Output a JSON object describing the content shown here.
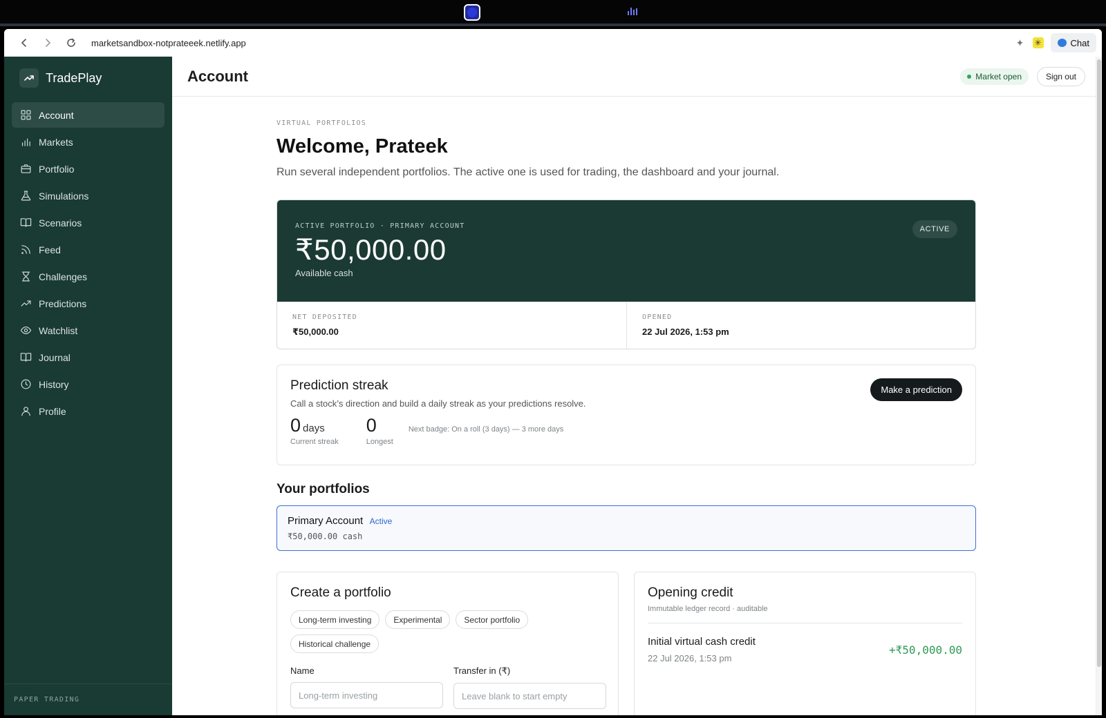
{
  "browser": {
    "url": "marketsandbox-notprateeek.netlify.app",
    "chat_label": "Chat"
  },
  "sidebar": {
    "brand": "TradePlay",
    "items": [
      {
        "label": "Account",
        "icon": "grid-icon"
      },
      {
        "label": "Markets",
        "icon": "bar-chart-icon"
      },
      {
        "label": "Portfolio",
        "icon": "briefcase-icon"
      },
      {
        "label": "Simulations",
        "icon": "flask-icon"
      },
      {
        "label": "Scenarios",
        "icon": "book-open-icon"
      },
      {
        "label": "Feed",
        "icon": "rss-icon"
      },
      {
        "label": "Challenges",
        "icon": "hourglass-icon"
      },
      {
        "label": "Predictions",
        "icon": "trending-up-icon"
      },
      {
        "label": "Watchlist",
        "icon": "eye-icon"
      },
      {
        "label": "Journal",
        "icon": "book-icon"
      },
      {
        "label": "History",
        "icon": "clock-icon"
      },
      {
        "label": "Profile",
        "icon": "user-icon"
      }
    ],
    "footer": "PAPER TRADING"
  },
  "header": {
    "title": "Account",
    "market_status": "Market open",
    "sign_out": "Sign out"
  },
  "intro": {
    "eyebrow": "VIRTUAL PORTFOLIOS",
    "welcome": "Welcome, Prateek",
    "lead": "Run several independent portfolios. The active one is used for trading, the dashboard and your journal."
  },
  "active_portfolio": {
    "eyebrow": "ACTIVE PORTFOLIO · PRIMARY ACCOUNT",
    "amount": "₹50,000.00",
    "amount_label": "Available cash",
    "badge": "ACTIVE",
    "net_deposited_label": "NET DEPOSITED",
    "net_deposited": "₹50,000.00",
    "opened_label": "OPENED",
    "opened": "22 Jul 2026, 1:53 pm"
  },
  "streak": {
    "title": "Prediction streak",
    "subtitle": "Call a stock’s direction and build a daily streak as your predictions resolve.",
    "button": "Make a prediction",
    "current": "0",
    "current_unit": "days",
    "current_label": "Current streak",
    "longest": "0",
    "longest_label": "Longest",
    "next_badge": "Next badge: On a roll (3 days) — 3 more days"
  },
  "portfolios": {
    "heading": "Your portfolios",
    "items": [
      {
        "name": "Primary Account",
        "status": "Active",
        "cash": "₹50,000.00 cash"
      }
    ]
  },
  "create": {
    "title": "Create a portfolio",
    "chips": [
      "Long-term investing",
      "Experimental",
      "Sector portfolio",
      "Historical challenge"
    ],
    "name_label": "Name",
    "name_placeholder": "Long-term investing",
    "transfer_label": "Transfer in (₹)",
    "transfer_placeholder": "Leave blank to start empty"
  },
  "opening_credit": {
    "title": "Opening credit",
    "subtitle": "Immutable ledger record · auditable",
    "entry_name": "Initial virtual cash credit",
    "entry_date": "22 Jul 2026, 1:53 pm",
    "entry_amount": "+₹50,000.00"
  },
  "colors": {
    "sidebar_bg": "#1a3a34",
    "card_dark": "#1b3a33",
    "accent_blue": "#3f6fd6",
    "positive_green": "#2f9a55"
  }
}
